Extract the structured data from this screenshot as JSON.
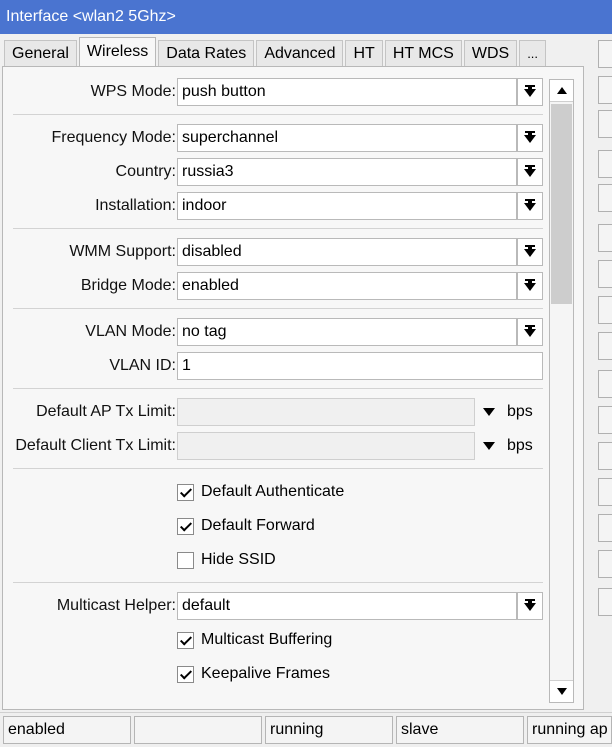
{
  "window": {
    "title": "Interface <wlan2 5Ghz>"
  },
  "tabs": [
    "General",
    "Wireless",
    "Data Rates",
    "Advanced",
    "HT",
    "HT MCS",
    "WDS",
    "..."
  ],
  "active_tab": "Wireless",
  "form": {
    "wps_mode": {
      "label": "WPS Mode:",
      "value": "push button"
    },
    "frequency_mode": {
      "label": "Frequency Mode:",
      "value": "superchannel"
    },
    "country": {
      "label": "Country:",
      "value": "russia3"
    },
    "installation": {
      "label": "Installation:",
      "value": "indoor"
    },
    "wmm_support": {
      "label": "WMM Support:",
      "value": "disabled"
    },
    "bridge_mode": {
      "label": "Bridge Mode:",
      "value": "enabled"
    },
    "vlan_mode": {
      "label": "VLAN Mode:",
      "value": "no tag"
    },
    "vlan_id": {
      "label": "VLAN ID:",
      "value": "1"
    },
    "default_ap_tx_limit": {
      "label": "Default AP Tx Limit:",
      "value": "",
      "unit": "bps"
    },
    "default_client_tx_limit": {
      "label": "Default Client Tx Limit:",
      "value": "",
      "unit": "bps"
    },
    "default_authenticate": {
      "label": "Default Authenticate",
      "checked": true
    },
    "default_forward": {
      "label": "Default Forward",
      "checked": true
    },
    "hide_ssid": {
      "label": "Hide SSID",
      "checked": false
    },
    "multicast_helper": {
      "label": "Multicast Helper:",
      "value": "default"
    },
    "multicast_buffering": {
      "label": "Multicast Buffering",
      "checked": true
    },
    "keepalive_frames": {
      "label": "Keepalive Frames",
      "checked": true
    }
  },
  "status_bar": [
    "enabled",
    "",
    "running",
    "slave",
    "running ap"
  ],
  "colors": {
    "titlebar": "#4a74d0",
    "panel": "#f7f7f7",
    "border": "#b9b9b9"
  }
}
